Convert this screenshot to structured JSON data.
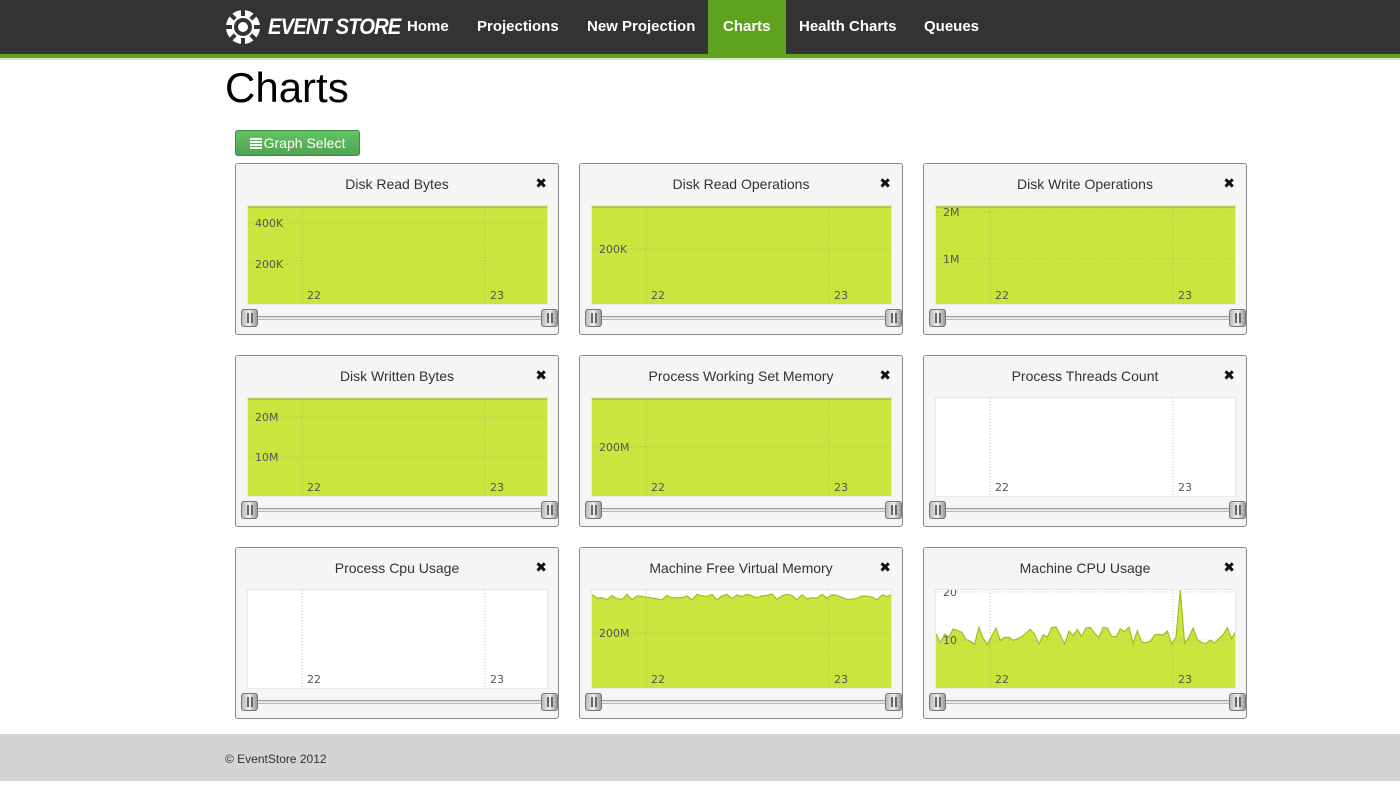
{
  "brand": {
    "name": "EVENT STORE"
  },
  "nav": {
    "items": [
      {
        "label": "Home",
        "active": false
      },
      {
        "label": "Projections",
        "active": false
      },
      {
        "label": "New Projection",
        "active": false
      },
      {
        "label": "Charts",
        "active": true
      },
      {
        "label": "Health Charts",
        "active": false
      },
      {
        "label": "Queues",
        "active": false
      }
    ]
  },
  "page": {
    "title": "Charts",
    "graph_select_label": "Graph Select"
  },
  "colors": {
    "accent": "#5fa21f",
    "chart_fill": "#cae53d",
    "chart_line": "#9bc124",
    "navbar": "#333333"
  },
  "charts": [
    {
      "title": "Disk Read Bytes",
      "close": "✖",
      "y_ticks": [
        "400K",
        "200K"
      ],
      "x_ticks": [
        "22",
        "23"
      ],
      "fill": "full"
    },
    {
      "title": "Disk Read Operations",
      "close": "✖",
      "y_ticks": [
        "200K"
      ],
      "x_ticks": [
        "22",
        "23"
      ],
      "fill": "full"
    },
    {
      "title": "Disk Write Operations",
      "close": "✖",
      "y_ticks": [
        "2M",
        "1M"
      ],
      "x_ticks": [
        "22",
        "23"
      ],
      "fill": "full"
    },
    {
      "title": "Disk Written Bytes",
      "close": "✖",
      "y_ticks": [
        "20M",
        "10M"
      ],
      "x_ticks": [
        "22",
        "23"
      ],
      "fill": "full"
    },
    {
      "title": "Process Working Set Memory",
      "close": "✖",
      "y_ticks": [
        "200M"
      ],
      "x_ticks": [
        "22",
        "23"
      ],
      "fill": "full"
    },
    {
      "title": "Process Threads Count",
      "close": "✖",
      "y_ticks": [],
      "x_ticks": [
        "22",
        "23"
      ],
      "fill": "empty"
    },
    {
      "title": "Process Cpu Usage",
      "close": "✖",
      "y_ticks": [],
      "x_ticks": [
        "22",
        "23"
      ],
      "fill": "empty"
    },
    {
      "title": "Machine Free Virtual Memory",
      "close": "✖",
      "y_ticks": [
        "200M"
      ],
      "x_ticks": [
        "22",
        "23"
      ],
      "fill": "wavy"
    },
    {
      "title": "Machine CPU Usage",
      "close": "✖",
      "y_ticks": [
        "20",
        "10"
      ],
      "x_ticks": [
        "22",
        "23"
      ],
      "fill": "spiky"
    }
  ],
  "footer": {
    "text": "© EventStore 2012"
  }
}
